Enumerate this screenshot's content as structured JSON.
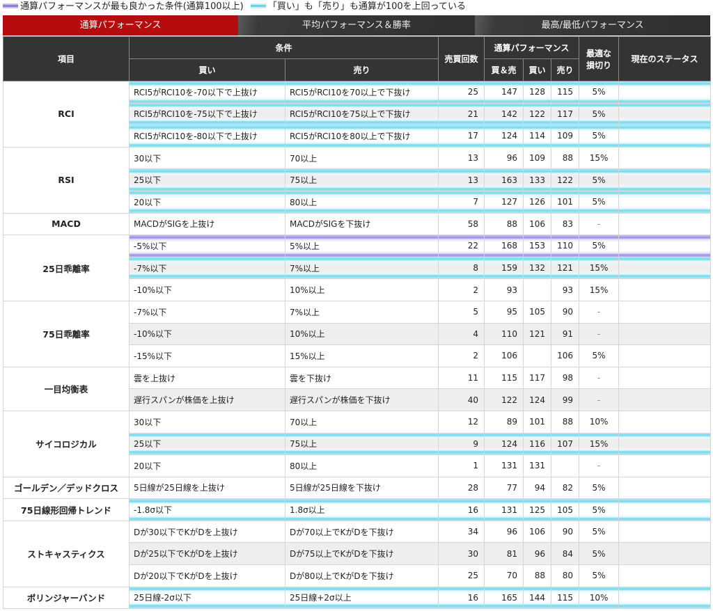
{
  "legend": {
    "best_overall": "通算パフォーマンスが最も良かった条件(通算100以上)",
    "both_over": "「買い」も「売り」も通算が100を上回っている"
  },
  "tabs": [
    {
      "label": "通算パフォーマンス",
      "active": true
    },
    {
      "label": "平均パフォーマンス＆勝率",
      "active": false
    },
    {
      "label": "最高/最低パフォーマンス",
      "active": false
    }
  ],
  "header": {
    "item": "項目",
    "condition": "条件",
    "buy": "買い",
    "sell": "売り",
    "count": "売買回数",
    "perf": "通算パフォーマンス",
    "both": "買＆売",
    "perf_buy": "買い",
    "perf_sell": "売り",
    "stoploss_line1": "最適な",
    "stoploss_line2": "損切り",
    "status": "現在のステータス"
  },
  "groups": [
    {
      "name": "RCI",
      "rows": [
        {
          "buy": "RCI5がRCI10を-70以下で上抜け",
          "sell": "RCI5がRCI10を70以上で下抜け",
          "count": "25",
          "both": "147",
          "pb": "128",
          "ps": "115",
          "sl": "5%",
          "hl": "cyan"
        },
        {
          "buy": "RCI5がRCI10を-75以下で上抜け",
          "sell": "RCI5がRCI10を75以上で下抜け",
          "count": "21",
          "both": "142",
          "pb": "122",
          "ps": "117",
          "sl": "5%",
          "hl": "cyan"
        },
        {
          "buy": "RCI5がRCI10を-80以下で上抜け",
          "sell": "RCI5がRCI10を80以上で下抜け",
          "count": "17",
          "both": "124",
          "pb": "114",
          "ps": "109",
          "sl": "5%",
          "hl": "cyan"
        }
      ]
    },
    {
      "name": "RSI",
      "rows": [
        {
          "buy": "30以下",
          "sell": "70以上",
          "count": "13",
          "both": "96",
          "pb": "109",
          "ps": "88",
          "sl": "15%",
          "hl": ""
        },
        {
          "buy": "25以下",
          "sell": "75以上",
          "count": "13",
          "both": "163",
          "pb": "133",
          "ps": "122",
          "sl": "5%",
          "hl": "cyan"
        },
        {
          "buy": "20以下",
          "sell": "80以上",
          "count": "7",
          "both": "127",
          "pb": "126",
          "ps": "101",
          "sl": "5%",
          "hl": "cyan"
        }
      ]
    },
    {
      "name": "MACD",
      "rows": [
        {
          "buy": "MACDがSIGを上抜け",
          "sell": "MACDがSIGを下抜け",
          "count": "58",
          "both": "88",
          "pb": "106",
          "ps": "83",
          "sl": "-",
          "hl": ""
        }
      ]
    },
    {
      "name": "25日乖離率",
      "rows": [
        {
          "buy": "-5%以下",
          "sell": "5%以上",
          "count": "22",
          "both": "168",
          "pb": "153",
          "ps": "110",
          "sl": "5%",
          "hl": "purple"
        },
        {
          "buy": "-7%以下",
          "sell": "7%以上",
          "count": "8",
          "both": "159",
          "pb": "132",
          "ps": "121",
          "sl": "15%",
          "hl": "cyan"
        },
        {
          "buy": "-10%以下",
          "sell": "10%以上",
          "count": "2",
          "both": "93",
          "pb": "",
          "ps": "93",
          "sl": "15%",
          "hl": ""
        }
      ]
    },
    {
      "name": "75日乖離率",
      "rows": [
        {
          "buy": "-7%以下",
          "sell": "7%以上",
          "count": "5",
          "both": "95",
          "pb": "105",
          "ps": "90",
          "sl": "-",
          "hl": ""
        },
        {
          "buy": "-10%以下",
          "sell": "10%以上",
          "count": "4",
          "both": "110",
          "pb": "121",
          "ps": "91",
          "sl": "-",
          "hl": ""
        },
        {
          "buy": "-15%以下",
          "sell": "15%以上",
          "count": "2",
          "both": "106",
          "pb": "",
          "ps": "106",
          "sl": "5%",
          "hl": ""
        }
      ]
    },
    {
      "name": "一目均衡表",
      "rows": [
        {
          "buy": "雲を上抜け",
          "sell": "雲を下抜け",
          "count": "11",
          "both": "115",
          "pb": "117",
          "ps": "98",
          "sl": "-",
          "hl": ""
        },
        {
          "buy": "遅行スパンが株価を上抜け",
          "sell": "遅行スパンが株価を下抜け",
          "count": "40",
          "both": "122",
          "pb": "124",
          "ps": "99",
          "sl": "-",
          "hl": ""
        }
      ]
    },
    {
      "name": "サイコロジカル",
      "rows": [
        {
          "buy": "30以下",
          "sell": "70以上",
          "count": "12",
          "both": "89",
          "pb": "101",
          "ps": "88",
          "sl": "10%",
          "hl": ""
        },
        {
          "buy": "25以下",
          "sell": "75以上",
          "count": "9",
          "both": "124",
          "pb": "116",
          "ps": "107",
          "sl": "15%",
          "hl": "cyan"
        },
        {
          "buy": "20以下",
          "sell": "80以上",
          "count": "1",
          "both": "131",
          "pb": "131",
          "ps": "",
          "sl": "-",
          "hl": ""
        }
      ]
    },
    {
      "name": "ゴールデン／デッドクロス",
      "rows": [
        {
          "buy": "5日線が25日線を上抜け",
          "sell": "5日線が25日線を下抜け",
          "count": "28",
          "both": "77",
          "pb": "94",
          "ps": "82",
          "sl": "5%",
          "hl": ""
        }
      ]
    },
    {
      "name": "75日線形回帰トレンド",
      "rows": [
        {
          "buy": "-1.8σ以下",
          "sell": "1.8σ以上",
          "count": "16",
          "both": "131",
          "pb": "125",
          "ps": "105",
          "sl": "5%",
          "hl": "cyan"
        }
      ]
    },
    {
      "name": "ストキャスティクス",
      "rows": [
        {
          "buy": "Dが30以下でKがDを上抜け",
          "sell": "Dが70以上でKがDを下抜け",
          "count": "34",
          "both": "96",
          "pb": "106",
          "ps": "90",
          "sl": "5%",
          "hl": ""
        },
        {
          "buy": "Dが25以下でKがDを上抜け",
          "sell": "Dが75以上でKがDを下抜け",
          "count": "30",
          "both": "81",
          "pb": "96",
          "ps": "84",
          "sl": "5%",
          "hl": ""
        },
        {
          "buy": "Dが20以下でKがDを上抜け",
          "sell": "Dが80以上でKがDを下抜け",
          "count": "25",
          "both": "70",
          "pb": "88",
          "ps": "80",
          "sl": "5%",
          "hl": ""
        }
      ]
    },
    {
      "name": "ボリンジャーバンド",
      "rows": [
        {
          "buy": "25日線-2σ以下",
          "sell": "25日線+2σ以上",
          "count": "16",
          "both": "165",
          "pb": "144",
          "ps": "115",
          "sl": "10%",
          "hl": "cyan"
        }
      ]
    }
  ]
}
